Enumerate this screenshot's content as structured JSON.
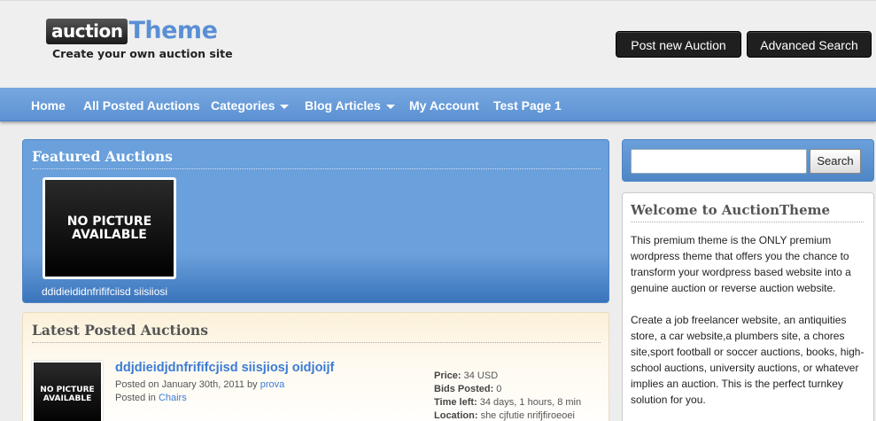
{
  "header": {
    "logo_word1": "auction",
    "logo_word2": "Theme",
    "tagline": "Create your own auction site",
    "post_button": "Post new Auction",
    "advanced_button": "Advanced Search"
  },
  "nav": {
    "items": [
      {
        "label": "Home"
      },
      {
        "label": "All Posted Auctions"
      },
      {
        "label": "Categories"
      },
      {
        "label": "Blog Articles"
      },
      {
        "label": "My Account"
      },
      {
        "label": "Test Page 1"
      }
    ]
  },
  "featured": {
    "title": "Featured Auctions",
    "no_picture_line1": "NO PICTURE",
    "no_picture_line2": "AVAILABLE",
    "item_caption": "ddidieididnfrififciisd siisiiosi"
  },
  "latest": {
    "title": "Latest Posted Auctions",
    "no_picture_line1": "NO PICTURE",
    "no_picture_line2": "AVAILABLE",
    "item_title": "ddjdieidjdnfrififcjisd siisjiosj oidjoijf",
    "posted_on": "Posted on January 30th, 2011 by",
    "posted_by": "prova",
    "posted_in": "Posted in",
    "category": "Chairs",
    "price_label": "Price:",
    "price": "34 USD",
    "bids_label": "Bids Posted:",
    "bids": "0",
    "time_label": "Time left:",
    "time": "34 days, 1 hours, 8 min",
    "location_label": "Location:",
    "location": "she cjfutie nrifjfiroeoei"
  },
  "sidebar": {
    "search_button": "Search",
    "search_placeholder": "",
    "welcome_title": "Welcome to AuctionTheme",
    "welcome_p1": "This premium theme is the ONLY premium wordpress theme that offers you the chance to transform your wordpress based website into a genuine auction or reverse auction website.",
    "welcome_p2": "Create a job freelancer website, an antiquities store, a car website,a plumbers site, a chores site,sport football or soccer auctions, books, high-school auctions, university auctions, or whatever implies an auction. This is the perfect turnkey solution for you."
  },
  "colors": {
    "nav_blue": "#5b91d3",
    "featured_blue": "#6aa0db",
    "link_blue": "#3a7bd5",
    "header_button": "#1f1f1f"
  }
}
